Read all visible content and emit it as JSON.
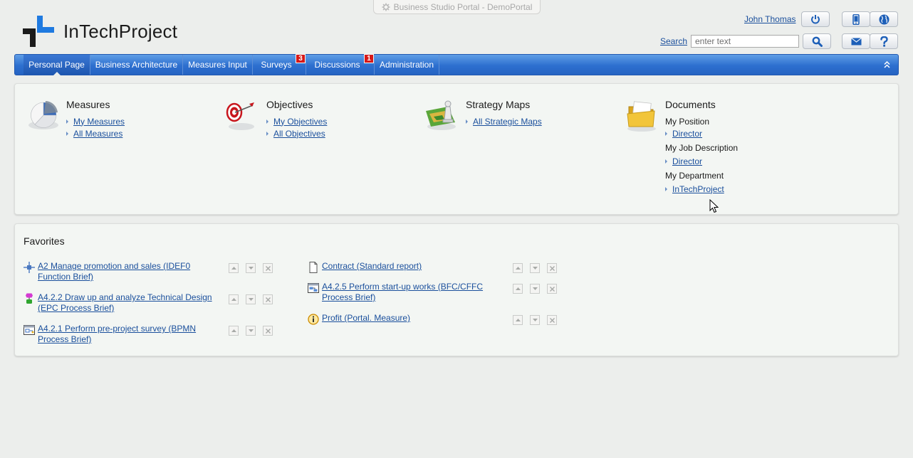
{
  "window": {
    "title": "Business Studio Portal - DemoPortal"
  },
  "brand": {
    "name": "InTechProject"
  },
  "header": {
    "user_name": "John Thomas",
    "search_label": "Search",
    "search_placeholder": "enter text",
    "search_value": ""
  },
  "nav": {
    "items": [
      {
        "label": "Personal Page",
        "active": true
      },
      {
        "label": "Business Architecture"
      },
      {
        "label": "Measures Input"
      },
      {
        "label": "Surveys",
        "badge": "3"
      },
      {
        "label": "Discussions",
        "badge": "1"
      },
      {
        "label": "Administration"
      }
    ]
  },
  "sections": {
    "measures": {
      "title": "Measures",
      "links": [
        "My Measures",
        "All Measures"
      ]
    },
    "objectives": {
      "title": "Objectives",
      "links": [
        "My Objectives",
        "All Objectives"
      ]
    },
    "strategy": {
      "title": "Strategy Maps",
      "links": [
        "All Strategic Maps"
      ]
    },
    "documents": {
      "title": "Documents",
      "groups": [
        {
          "label": "My Position",
          "link": "Director"
        },
        {
          "label": "My Job Description",
          "link": "Director"
        },
        {
          "label": "My Department",
          "link": "InTechProject"
        }
      ]
    }
  },
  "favorites": {
    "title": "Favorites",
    "left": [
      {
        "label": "A2 Manage promotion and sales (IDEF0 Function Brief)",
        "icon": "idef0-function-icon"
      },
      {
        "label": "A4.2.2 Draw up and analyze Technical Design (EPC Process Brief)",
        "icon": "epc-process-icon"
      },
      {
        "label": "A4.2.1 Perform pre-project survey (BPMN Process Brief)",
        "icon": "bpmn-process-icon"
      }
    ],
    "right": [
      {
        "label": "Contract (Standard report)",
        "icon": "document-icon"
      },
      {
        "label": "A4.2.5 Perform start-up works (BFC/CFFC Process Brief)",
        "icon": "bfc-process-icon"
      },
      {
        "label": "Profit (Portal. Measure)",
        "icon": "measure-info-icon"
      }
    ]
  },
  "colors": {
    "nav_blue": "#2d6fcf",
    "link_blue": "#1a4f9c",
    "badge_red": "#d61818",
    "logo_blue": "#1f7ae0"
  }
}
